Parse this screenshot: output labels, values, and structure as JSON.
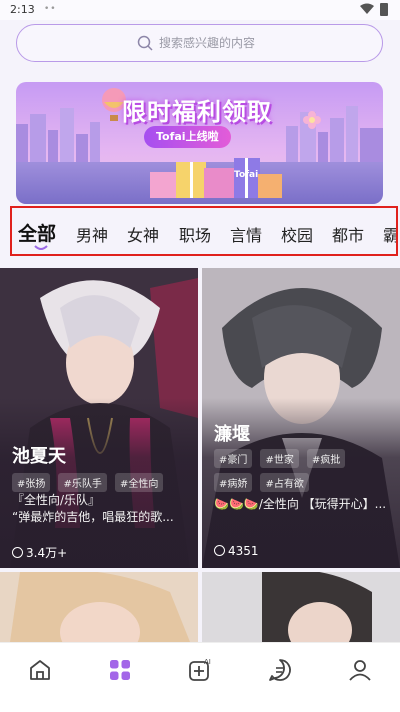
{
  "status_bar": {
    "time": "2:13",
    "dots": "••"
  },
  "search": {
    "placeholder": "搜索感兴趣的内容"
  },
  "banner": {
    "title": "限时福利领取",
    "subtitle": "Tofai上线啦",
    "gift_label": "Tofai"
  },
  "tabs": [
    "全部",
    "男神",
    "女神",
    "职场",
    "言情",
    "校园",
    "都市",
    "霸"
  ],
  "active_tab": "全部",
  "cards": [
    {
      "name": "池夏天",
      "tags": [
        "#张扬",
        "#乐队手",
        "#全性向"
      ],
      "desc": "『全性向/乐队』\n“弹最炸的吉他，唱最狂的歌...",
      "count": "3.4万+"
    },
    {
      "name": "濂堰",
      "tags": [
        "#豪门",
        "#世家",
        "#疯批",
        "#病娇",
        "#占有欲"
      ],
      "desc": "🍉🍉🍉/全性向  【玩得开心】...",
      "count": "4351"
    }
  ],
  "bottom_nav": [
    "home-icon",
    "discover-icon",
    "create-ai-icon",
    "messages-icon",
    "profile-icon"
  ],
  "colors": {
    "accent": "#9b6ae6",
    "active_nav": "#a366e8",
    "tab_border": "#e0201c"
  }
}
